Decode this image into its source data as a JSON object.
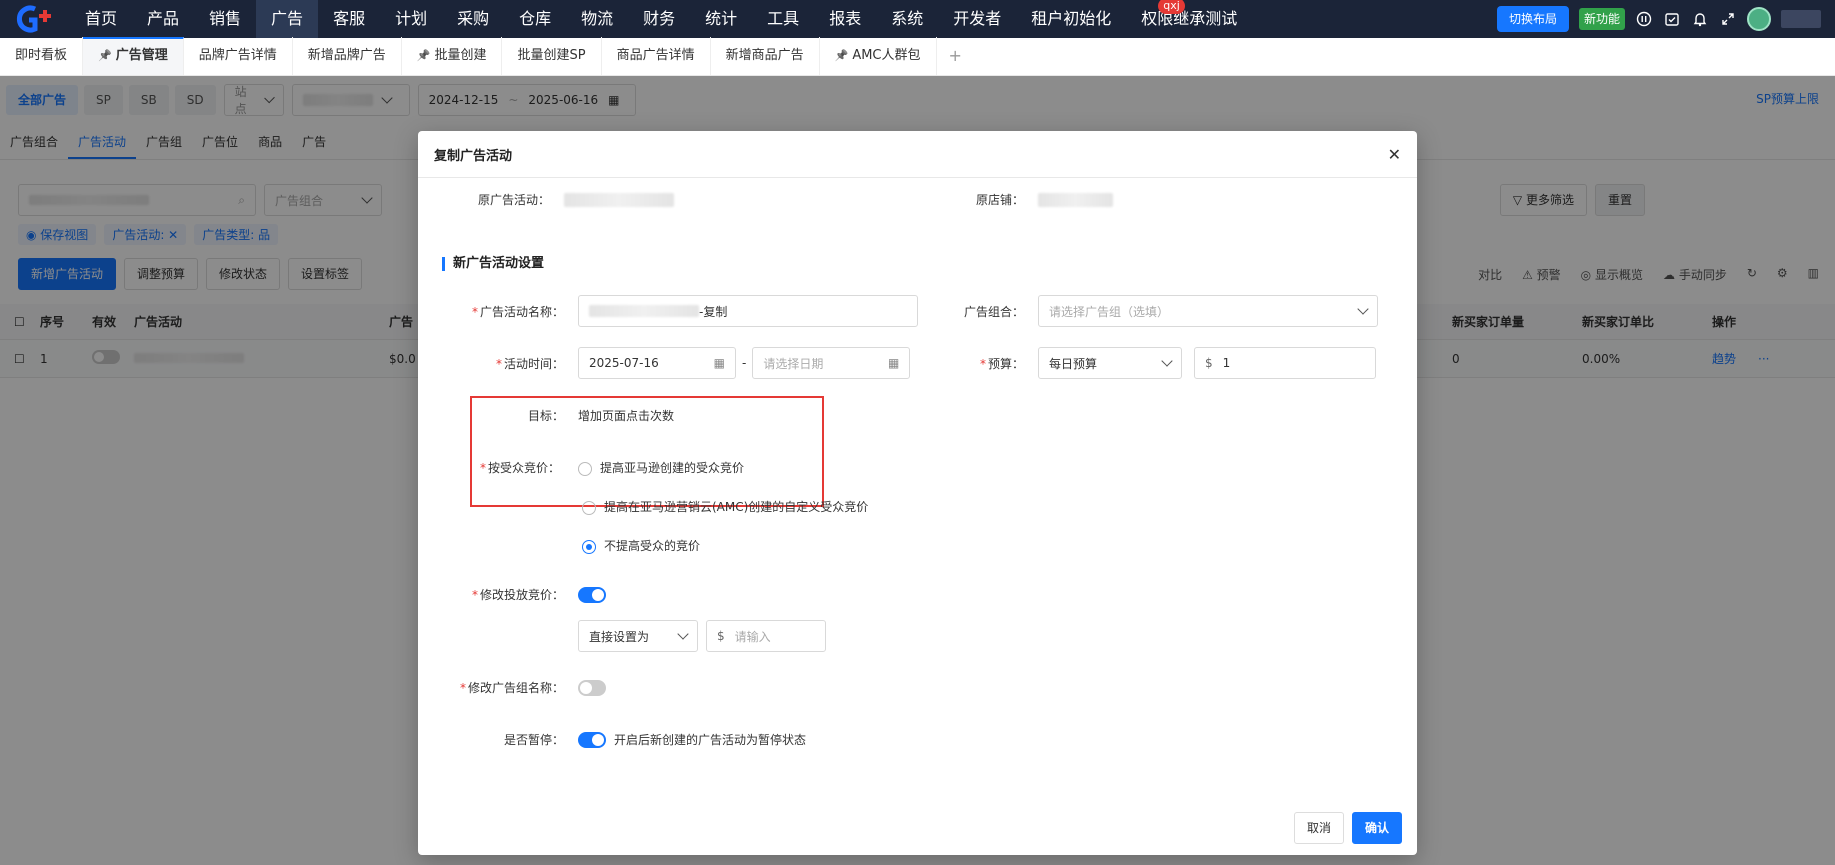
{
  "topnav": {
    "items": [
      "首页",
      "产品",
      "销售",
      "广告",
      "客服",
      "计划",
      "采购",
      "仓库",
      "物流",
      "财务",
      "统计",
      "工具",
      "报表",
      "系统",
      "开发者",
      "租户初始化",
      "权限继承测试"
    ],
    "active_index": 3,
    "badge": "qxj",
    "switch_layout": "切换布局",
    "new_feature": "新功能"
  },
  "tabs": {
    "items": [
      "即时看板",
      "广告管理",
      "品牌广告详情",
      "新增品牌广告",
      "批量创建",
      "批量创建SP",
      "商品广告详情",
      "新增商品广告",
      "AMC人群包"
    ],
    "active_index": 1,
    "add": "+"
  },
  "filter": {
    "segments": [
      "全部广告",
      "SP",
      "SB",
      "SD"
    ],
    "site_placeholder": "站点",
    "date_start": "2024-12-15",
    "date_sep": "~",
    "date_end": "2025-06-16",
    "sp_budget_link": "SP预算上限"
  },
  "subtabs": [
    "广告组合",
    "广告活动",
    "广告组",
    "广告位",
    "商品",
    "广告"
  ],
  "toolbar": {
    "portfolio_placeholder": "广告组合",
    "more_filter": "更多筛选",
    "reset": "重置",
    "save_view": "保存视图",
    "chip_campaign": "广告活动:",
    "chip_type": "广告类型: 品",
    "add_campaign": "新增广告活动",
    "adjust_budget": "调整预算",
    "modify_status": "修改状态",
    "set_tag": "设置标签",
    "compare": "对比",
    "alert": "预警",
    "show_overview": "显示概览",
    "manual_sync": "手动同步"
  },
  "table": {
    "headers": [
      "序号",
      "有效",
      "广告活动",
      "广告",
      "新买家订单量",
      "新买家订单比",
      "操作"
    ],
    "row": {
      "index": "1",
      "amount": "$0.0",
      "orders": "0",
      "ratio": "0.00%",
      "trend": "趋势",
      "more": "···"
    }
  },
  "modal": {
    "title": "复制广告活动",
    "orig_campaign_label": "原广告活动：",
    "orig_store_label": "原店铺：",
    "section_title": "新广告活动设置",
    "name_label": "广告活动名称：",
    "name_suffix": "-复制",
    "portfolio_label": "广告组合：",
    "portfolio_placeholder": "请选择广告组（选填）",
    "time_label": "活动时间：",
    "start_date": "2025-07-16",
    "date_sep": "-",
    "end_placeholder": "请选择日期",
    "budget_label": "预算：",
    "budget_type": "每日预算",
    "currency": "$",
    "budget_value": "1",
    "goal_label": "目标：",
    "goal_value": "增加页面点击次数",
    "audience_label": "按受众竞价：",
    "audience_options": [
      "提高亚马逊创建的受众竞价",
      "提高在亚马逊营销云(AMC)创建的自定义受众竞价",
      "不提高受众的竞价"
    ],
    "audience_selected": 2,
    "modify_bid_label": "修改投放竞价：",
    "bid_mode": "直接设置为",
    "bid_placeholder": "请输入",
    "modify_group_label": "修改广告组名称：",
    "pause_label": "是否暂停：",
    "pause_desc": "开启后新创建的广告活动为暂停状态",
    "cancel": "取消",
    "confirm": "确认"
  }
}
